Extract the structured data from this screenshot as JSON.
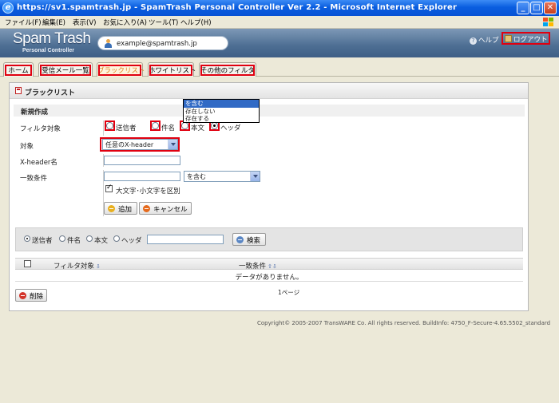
{
  "window": {
    "title": "https://sv1.spamtrash.jp - SpamTrash Personal Controller Ver 2.2 - Microsoft Internet Explorer",
    "minimize": "_",
    "maximize": "□",
    "close": "✕"
  },
  "menu": [
    "ファイル(F)",
    "編集(E)",
    "表示(V)",
    "お気に入り(A)",
    "ツール(T)",
    "ヘルプ(H)"
  ],
  "header": {
    "logo": "Spam Trash",
    "logo_sub": "Personal Controller",
    "user_email": "example@spamtrash.jp",
    "help": "ヘルプ",
    "logout": "ログアウト"
  },
  "tabs": [
    {
      "label": "ホーム"
    },
    {
      "label": "受信メール一覧"
    },
    {
      "label": "ブラックリスト",
      "active": true
    },
    {
      "label": "ホワイトリスト"
    },
    {
      "label": "その他のフィルタ"
    }
  ],
  "panel": {
    "title": "ブラックリスト",
    "section": "新規作成",
    "filter_target_label": "フィルタ対象",
    "filter_options": [
      {
        "label": "送信者",
        "selected": false
      },
      {
        "label": "件名",
        "selected": false
      },
      {
        "label": "本文",
        "selected": false
      },
      {
        "label": "ヘッダ",
        "selected": true
      }
    ],
    "target_label": "対象",
    "target_value": "任意のX-header",
    "xheader_label": "X-header名",
    "xheader_value": "",
    "match_label": "一致条件",
    "match_value": "",
    "match_condition": "を含む",
    "match_options": [
      "を含む",
      "存在しない",
      "存在する"
    ],
    "case_sensitive_label": "大文字･小文字を区別",
    "case_sensitive": true,
    "add_button": "追加",
    "cancel_button": "キャンセル"
  },
  "search": {
    "options": [
      {
        "label": "送信者",
        "selected": true
      },
      {
        "label": "件名",
        "selected": false
      },
      {
        "label": "本文",
        "selected": false
      },
      {
        "label": "ヘッダ",
        "selected": false
      }
    ],
    "query": "",
    "button": "検索"
  },
  "table": {
    "col_filter": "フィルタ対象",
    "col_match": "一致条件",
    "empty": "データがありません。"
  },
  "pagination": "1ページ",
  "delete_button": "削除",
  "footer": "Copyright© 2005-2007 TransWARE Co. All rights reserved. BuildInfo: 4750_F-Secure-4.65.5502_standard",
  "colors": {
    "highlight": "#e00010",
    "header_bg": "#4d6e93",
    "titlebar": "#0a5ee0"
  }
}
